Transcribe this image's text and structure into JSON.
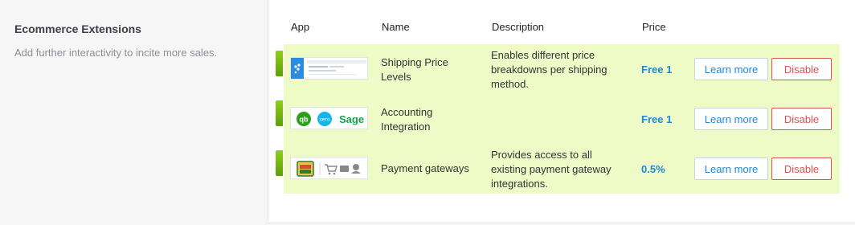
{
  "section": {
    "title": "Ecommerce Extensions",
    "description": "Add further interactivity to incite more sales."
  },
  "table": {
    "headers": {
      "app": "App",
      "name": "Name",
      "description": "Description",
      "price": "Price"
    },
    "rows": [
      {
        "name_line1": "Shipping Price",
        "name_line2": "Levels",
        "desc_line1": "Enables different price",
        "desc_line2": "breakdowns per shipping",
        "desc_line3": "method.",
        "price": "Free 1",
        "learn_label": "Learn more",
        "disable_label": "Disable"
      },
      {
        "name_line1": "Accounting",
        "name_line2": "Integration",
        "price": "Free 1",
        "learn_label": "Learn more",
        "disable_label": "Disable",
        "logos": {
          "quickbooks": "qb",
          "xero": "xero",
          "sage": "Sage"
        }
      },
      {
        "name_line1": "Payment gateways",
        "desc_line1": "Provides access to all",
        "desc_line2": "existing payment gateway",
        "desc_line3": "integrations.",
        "price": "0.5%",
        "learn_label": "Learn more",
        "disable_label": "Disable"
      }
    ]
  },
  "colors": {
    "row_bg": "#eefbc6",
    "price": "#1e88d9",
    "disable": "#d9534f",
    "marker": "#7bbf12"
  }
}
